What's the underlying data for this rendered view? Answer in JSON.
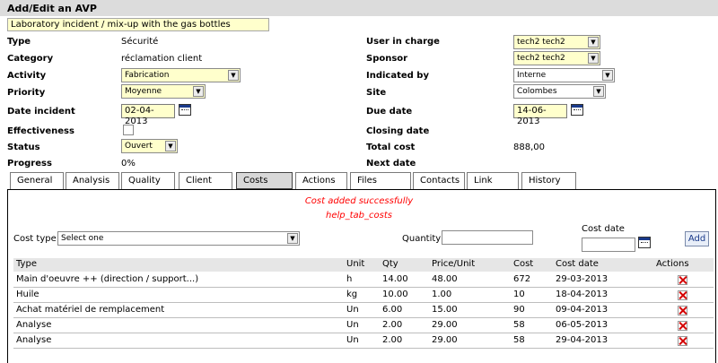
{
  "header": {
    "title": "Add/Edit an AVP"
  },
  "form": {
    "title_value": "Laboratory incident / mix-up with the gas bottles",
    "type": {
      "label": "Type",
      "value": "Sécurité"
    },
    "category": {
      "label": "Category",
      "value": "réclamation client"
    },
    "activity": {
      "label": "Activity",
      "value": "Fabrication"
    },
    "priority": {
      "label": "Priority",
      "value": "Moyenne"
    },
    "date_incident": {
      "label": "Date incident",
      "value": "02-04-2013"
    },
    "effectiveness": {
      "label": "Effectiveness"
    },
    "status": {
      "label": "Status",
      "value": "Ouvert"
    },
    "progress": {
      "label": "Progress",
      "value": "0%"
    },
    "user_in_charge": {
      "label": "User in charge",
      "value": "tech2 tech2"
    },
    "sponsor": {
      "label": "Sponsor",
      "value": "tech2 tech2"
    },
    "indicated_by": {
      "label": "Indicated by",
      "value": "Interne"
    },
    "site": {
      "label": "Site",
      "value": "Colombes"
    },
    "due_date": {
      "label": "Due date",
      "value": "14-06-2013"
    },
    "closing_date": {
      "label": "Closing date"
    },
    "total_cost": {
      "label": "Total cost",
      "value": "888,00"
    },
    "next_date": {
      "label": "Next date"
    }
  },
  "tabs": [
    {
      "label": "General"
    },
    {
      "label": "Analysis"
    },
    {
      "label": "Quality"
    },
    {
      "label": "Client"
    },
    {
      "label": "Costs"
    },
    {
      "label": "Actions"
    },
    {
      "label": "Files"
    },
    {
      "label": "Contacts"
    },
    {
      "label": "Link"
    },
    {
      "label": "History"
    }
  ],
  "costs": {
    "success_msg": "Cost added successfully",
    "help_msg": "help_tab_costs",
    "cost_type_label": "Cost type",
    "cost_type_value": "Select one",
    "quantity_label": "Quantity",
    "cost_date_label": "Cost date",
    "add_label": "Add",
    "columns": {
      "type": "Type",
      "unit": "Unit",
      "qty": "Qty",
      "price": "Price/Unit",
      "cost": "Cost",
      "date": "Cost date",
      "actions": "Actions"
    },
    "rows": [
      {
        "type": "Main d'oeuvre ++ (direction / support...)",
        "unit": "h",
        "qty": "14.00",
        "price": "48.00",
        "cost": "672",
        "date": "29-03-2013"
      },
      {
        "type": "Huile",
        "unit": "kg",
        "qty": "10.00",
        "price": "1.00",
        "cost": "10",
        "date": "18-04-2013"
      },
      {
        "type": "Achat matériel de remplacement",
        "unit": "Un",
        "qty": "6.00",
        "price": "15.00",
        "cost": "90",
        "date": "09-04-2013"
      },
      {
        "type": "Analyse",
        "unit": "Un",
        "qty": "2.00",
        "price": "29.00",
        "cost": "58",
        "date": "06-05-2013"
      },
      {
        "type": "Analyse",
        "unit": "Un",
        "qty": "2.00",
        "price": "29.00",
        "cost": "58",
        "date": "29-04-2013"
      }
    ]
  }
}
